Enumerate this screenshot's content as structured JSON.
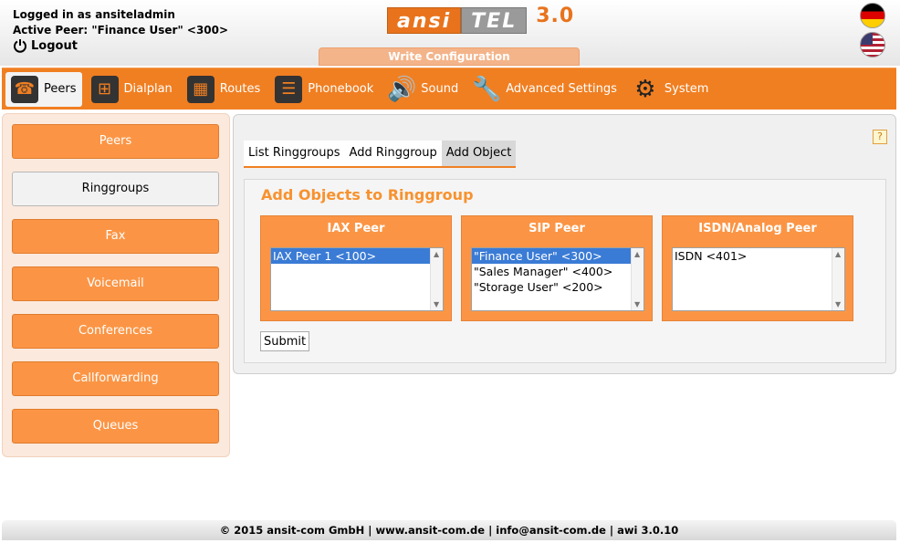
{
  "header": {
    "logged_in": "Logged in as ansiteladmin",
    "active_peer": "Active Peer: \"Finance User\" <300>",
    "logout": "Logout",
    "logo_ansi": "ansi",
    "logo_tel": "TEL",
    "logo_version": "3.0",
    "write_config": "Write Configuration",
    "flags": [
      "german-flag-icon",
      "us-flag-icon"
    ]
  },
  "nav": {
    "items": [
      {
        "label": "Peers",
        "icon": "☎"
      },
      {
        "label": "Dialplan",
        "icon": "⊞"
      },
      {
        "label": "Routes",
        "icon": "▦"
      },
      {
        "label": "Phonebook",
        "icon": "☰"
      },
      {
        "label": "Sound",
        "icon": "🔊"
      },
      {
        "label": "Advanced Settings",
        "icon": "🔧"
      },
      {
        "label": "System",
        "icon": "⚙"
      }
    ]
  },
  "sidebar": {
    "items": [
      "Peers",
      "Ringgroups",
      "Fax",
      "Voicemail",
      "Conferences",
      "Callforwarding",
      "Queues"
    ],
    "active": "Ringgroups"
  },
  "main": {
    "help": "?",
    "tabs": [
      "List Ringgroups",
      "Add Ringgroup",
      "Add Object"
    ],
    "active_tab": "Add Object",
    "title": "Add Objects to Ringgroup",
    "boxes": [
      {
        "title": "IAX Peer",
        "options": [
          "IAX Peer 1 <100>"
        ],
        "selected": 0
      },
      {
        "title": "SIP Peer",
        "options": [
          "\"Finance User\" <300>",
          "\"Sales Manager\" <400>",
          "\"Storage User\" <200>"
        ],
        "selected": 0
      },
      {
        "title": "ISDN/Analog Peer",
        "options": [
          "ISDN <401>"
        ],
        "selected": -1
      }
    ],
    "submit": "Submit"
  },
  "footer": {
    "text": "© 2015 ansit-com GmbH | www.ansit-com.de | info@ansit-com.de | awi 3.0.10"
  },
  "colors": {
    "accent": "#f07f22",
    "button": "#fb9545",
    "title": "#f7922f",
    "selection": "#3a7bd5"
  }
}
